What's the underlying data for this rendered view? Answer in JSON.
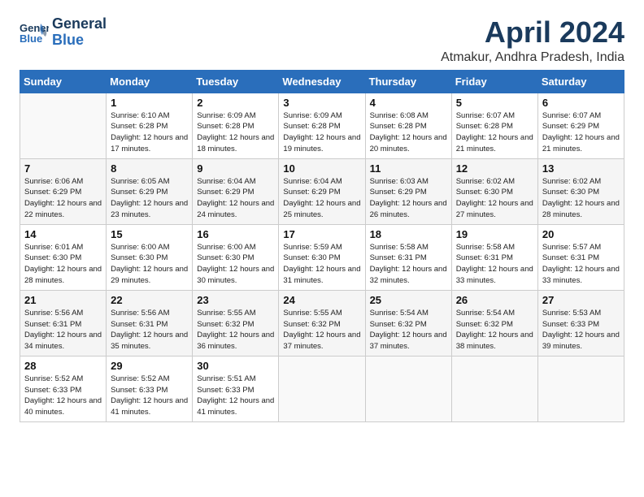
{
  "header": {
    "logo_line1": "General",
    "logo_line2": "Blue",
    "month_title": "April 2024",
    "location": "Atmakur, Andhra Pradesh, India"
  },
  "days_of_week": [
    "Sunday",
    "Monday",
    "Tuesday",
    "Wednesday",
    "Thursday",
    "Friday",
    "Saturday"
  ],
  "weeks": [
    [
      {
        "day": "",
        "sunrise": "",
        "sunset": "",
        "daylight": ""
      },
      {
        "day": "1",
        "sunrise": "Sunrise: 6:10 AM",
        "sunset": "Sunset: 6:28 PM",
        "daylight": "Daylight: 12 hours and 17 minutes."
      },
      {
        "day": "2",
        "sunrise": "Sunrise: 6:09 AM",
        "sunset": "Sunset: 6:28 PM",
        "daylight": "Daylight: 12 hours and 18 minutes."
      },
      {
        "day": "3",
        "sunrise": "Sunrise: 6:09 AM",
        "sunset": "Sunset: 6:28 PM",
        "daylight": "Daylight: 12 hours and 19 minutes."
      },
      {
        "day": "4",
        "sunrise": "Sunrise: 6:08 AM",
        "sunset": "Sunset: 6:28 PM",
        "daylight": "Daylight: 12 hours and 20 minutes."
      },
      {
        "day": "5",
        "sunrise": "Sunrise: 6:07 AM",
        "sunset": "Sunset: 6:28 PM",
        "daylight": "Daylight: 12 hours and 21 minutes."
      },
      {
        "day": "6",
        "sunrise": "Sunrise: 6:07 AM",
        "sunset": "Sunset: 6:29 PM",
        "daylight": "Daylight: 12 hours and 21 minutes."
      }
    ],
    [
      {
        "day": "7",
        "sunrise": "Sunrise: 6:06 AM",
        "sunset": "Sunset: 6:29 PM",
        "daylight": "Daylight: 12 hours and 22 minutes."
      },
      {
        "day": "8",
        "sunrise": "Sunrise: 6:05 AM",
        "sunset": "Sunset: 6:29 PM",
        "daylight": "Daylight: 12 hours and 23 minutes."
      },
      {
        "day": "9",
        "sunrise": "Sunrise: 6:04 AM",
        "sunset": "Sunset: 6:29 PM",
        "daylight": "Daylight: 12 hours and 24 minutes."
      },
      {
        "day": "10",
        "sunrise": "Sunrise: 6:04 AM",
        "sunset": "Sunset: 6:29 PM",
        "daylight": "Daylight: 12 hours and 25 minutes."
      },
      {
        "day": "11",
        "sunrise": "Sunrise: 6:03 AM",
        "sunset": "Sunset: 6:29 PM",
        "daylight": "Daylight: 12 hours and 26 minutes."
      },
      {
        "day": "12",
        "sunrise": "Sunrise: 6:02 AM",
        "sunset": "Sunset: 6:30 PM",
        "daylight": "Daylight: 12 hours and 27 minutes."
      },
      {
        "day": "13",
        "sunrise": "Sunrise: 6:02 AM",
        "sunset": "Sunset: 6:30 PM",
        "daylight": "Daylight: 12 hours and 28 minutes."
      }
    ],
    [
      {
        "day": "14",
        "sunrise": "Sunrise: 6:01 AM",
        "sunset": "Sunset: 6:30 PM",
        "daylight": "Daylight: 12 hours and 28 minutes."
      },
      {
        "day": "15",
        "sunrise": "Sunrise: 6:00 AM",
        "sunset": "Sunset: 6:30 PM",
        "daylight": "Daylight: 12 hours and 29 minutes."
      },
      {
        "day": "16",
        "sunrise": "Sunrise: 6:00 AM",
        "sunset": "Sunset: 6:30 PM",
        "daylight": "Daylight: 12 hours and 30 minutes."
      },
      {
        "day": "17",
        "sunrise": "Sunrise: 5:59 AM",
        "sunset": "Sunset: 6:30 PM",
        "daylight": "Daylight: 12 hours and 31 minutes."
      },
      {
        "day": "18",
        "sunrise": "Sunrise: 5:58 AM",
        "sunset": "Sunset: 6:31 PM",
        "daylight": "Daylight: 12 hours and 32 minutes."
      },
      {
        "day": "19",
        "sunrise": "Sunrise: 5:58 AM",
        "sunset": "Sunset: 6:31 PM",
        "daylight": "Daylight: 12 hours and 33 minutes."
      },
      {
        "day": "20",
        "sunrise": "Sunrise: 5:57 AM",
        "sunset": "Sunset: 6:31 PM",
        "daylight": "Daylight: 12 hours and 33 minutes."
      }
    ],
    [
      {
        "day": "21",
        "sunrise": "Sunrise: 5:56 AM",
        "sunset": "Sunset: 6:31 PM",
        "daylight": "Daylight: 12 hours and 34 minutes."
      },
      {
        "day": "22",
        "sunrise": "Sunrise: 5:56 AM",
        "sunset": "Sunset: 6:31 PM",
        "daylight": "Daylight: 12 hours and 35 minutes."
      },
      {
        "day": "23",
        "sunrise": "Sunrise: 5:55 AM",
        "sunset": "Sunset: 6:32 PM",
        "daylight": "Daylight: 12 hours and 36 minutes."
      },
      {
        "day": "24",
        "sunrise": "Sunrise: 5:55 AM",
        "sunset": "Sunset: 6:32 PM",
        "daylight": "Daylight: 12 hours and 37 minutes."
      },
      {
        "day": "25",
        "sunrise": "Sunrise: 5:54 AM",
        "sunset": "Sunset: 6:32 PM",
        "daylight": "Daylight: 12 hours and 37 minutes."
      },
      {
        "day": "26",
        "sunrise": "Sunrise: 5:54 AM",
        "sunset": "Sunset: 6:32 PM",
        "daylight": "Daylight: 12 hours and 38 minutes."
      },
      {
        "day": "27",
        "sunrise": "Sunrise: 5:53 AM",
        "sunset": "Sunset: 6:33 PM",
        "daylight": "Daylight: 12 hours and 39 minutes."
      }
    ],
    [
      {
        "day": "28",
        "sunrise": "Sunrise: 5:52 AM",
        "sunset": "Sunset: 6:33 PM",
        "daylight": "Daylight: 12 hours and 40 minutes."
      },
      {
        "day": "29",
        "sunrise": "Sunrise: 5:52 AM",
        "sunset": "Sunset: 6:33 PM",
        "daylight": "Daylight: 12 hours and 41 minutes."
      },
      {
        "day": "30",
        "sunrise": "Sunrise: 5:51 AM",
        "sunset": "Sunset: 6:33 PM",
        "daylight": "Daylight: 12 hours and 41 minutes."
      },
      {
        "day": "",
        "sunrise": "",
        "sunset": "",
        "daylight": ""
      },
      {
        "day": "",
        "sunrise": "",
        "sunset": "",
        "daylight": ""
      },
      {
        "day": "",
        "sunrise": "",
        "sunset": "",
        "daylight": ""
      },
      {
        "day": "",
        "sunrise": "",
        "sunset": "",
        "daylight": ""
      }
    ]
  ]
}
